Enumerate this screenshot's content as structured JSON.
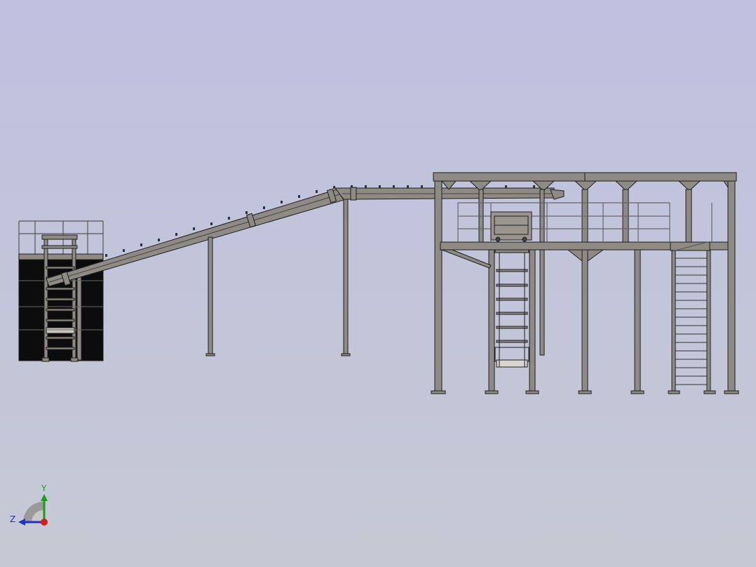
{
  "viewport": {
    "background_top": "#bfc0e0",
    "background_bottom": "#c6c9d4",
    "steel_color": "#8e8a84",
    "steel_outline": "#1e1e1e",
    "cladding_color": "#0c0c0c"
  },
  "triad": {
    "y_label": "Y",
    "z_label": "Z",
    "y_color": "#18a018",
    "z_color": "#1c2fd8",
    "x_color": "#d81c1c"
  }
}
